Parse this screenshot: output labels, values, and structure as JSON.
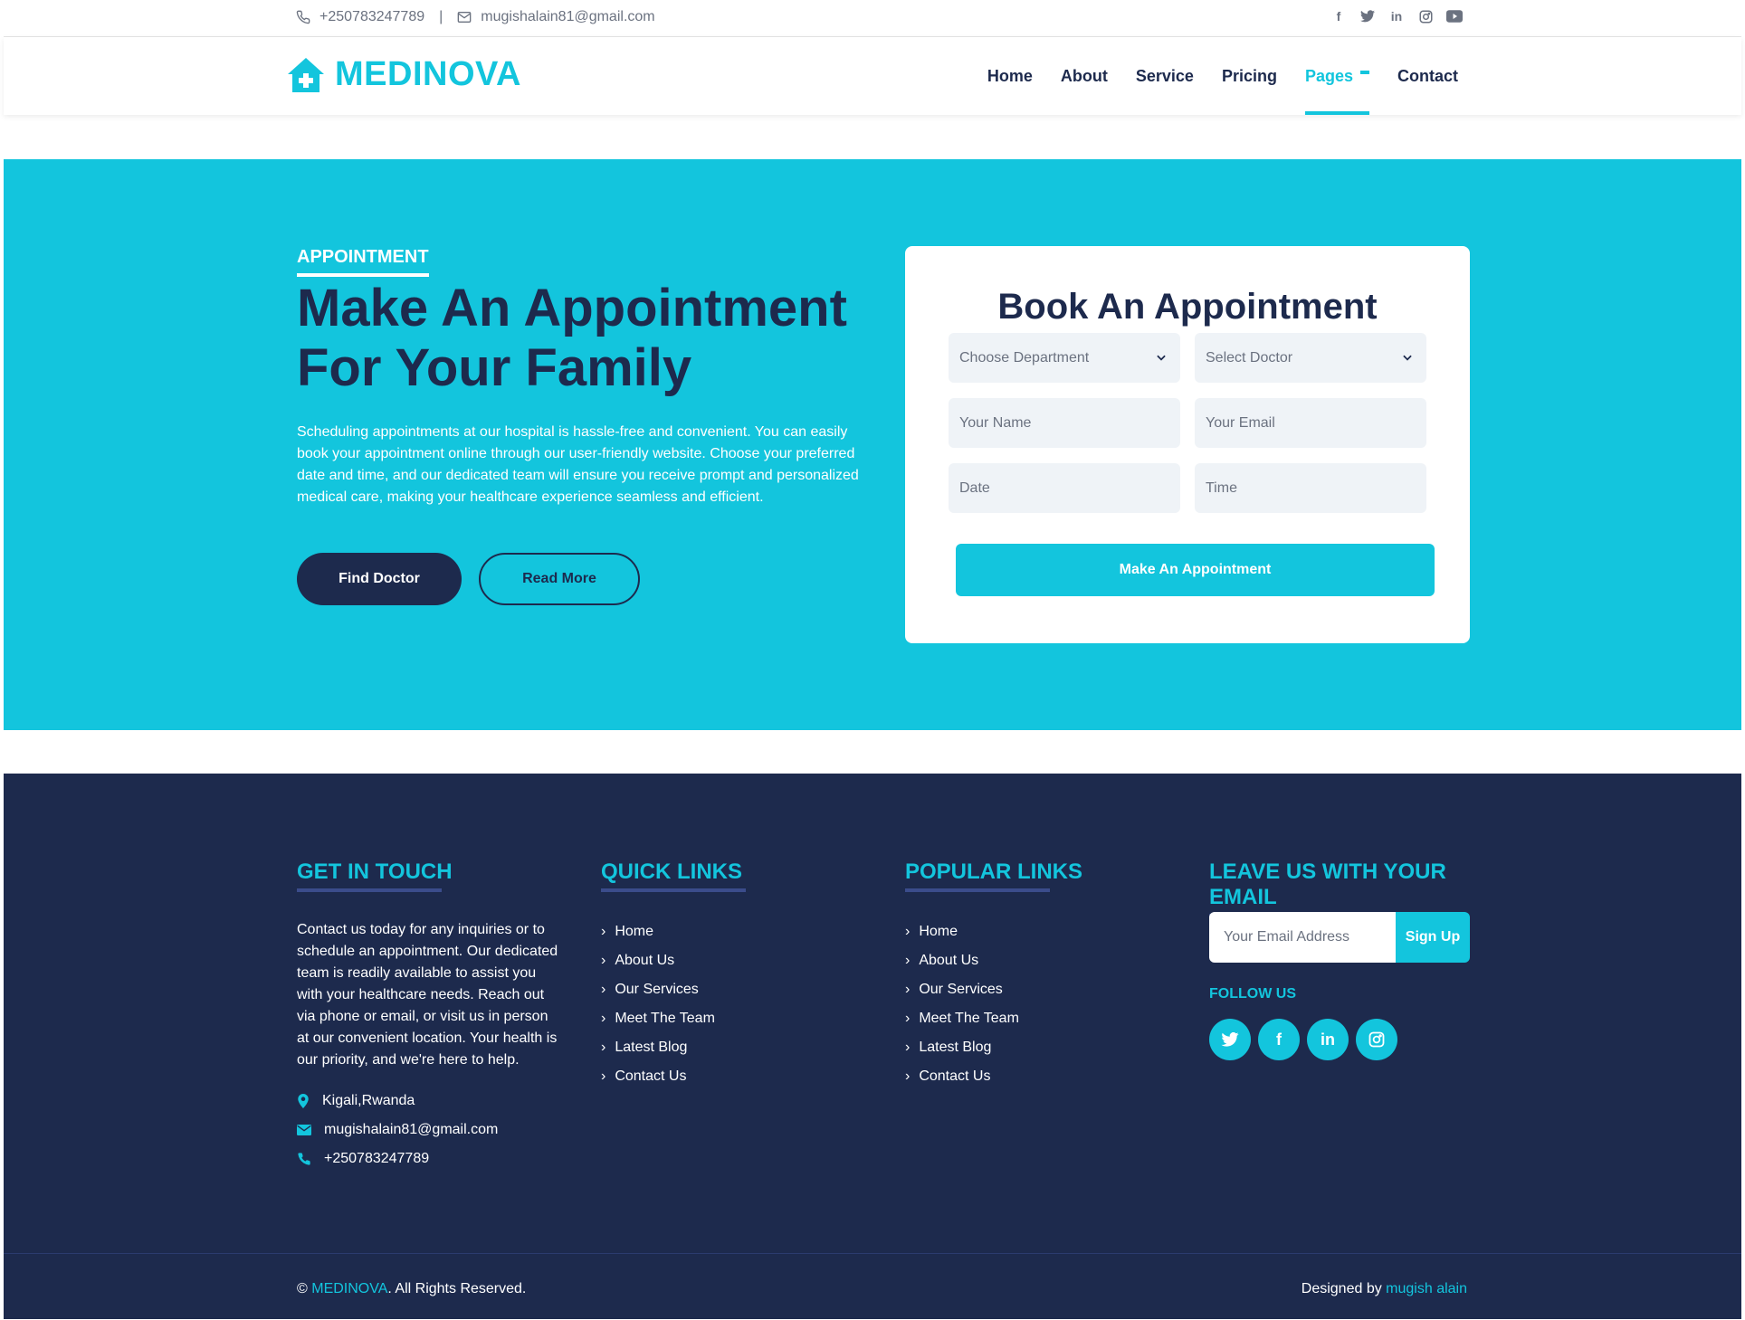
{
  "topbar": {
    "phone": "+250783247789",
    "separator": "|",
    "email": "mugishalain81@gmail.com"
  },
  "brand": {
    "name": "MEDINOVA",
    "accent": "#13c5dd",
    "dark": "#1d2a4d"
  },
  "nav": {
    "items": [
      "Home",
      "About",
      "Service",
      "Pricing",
      "Pages",
      "Contact"
    ],
    "active": "Pages"
  },
  "hero": {
    "kicker": "APPOINTMENT",
    "title": "Make An Appointment For Your Family",
    "description": "Scheduling appointments at our hospital is hassle-free and convenient. You can easily book your appointment online through our user-friendly website. Choose your preferred date and time, and our dedicated team will ensure you receive prompt and personalized medical care, making your healthcare experience seamless and efficient.",
    "primary_button": "Find Doctor",
    "secondary_button": "Read More"
  },
  "form": {
    "title": "Book An Appointment",
    "department_placeholder": "Choose Department",
    "doctor_placeholder": "Select Doctor",
    "name_placeholder": "Your Name",
    "email_placeholder": "Your Email",
    "date_placeholder": "Date",
    "time_placeholder": "Time",
    "submit": "Make An Appointment"
  },
  "footer": {
    "get_in_touch": {
      "title": "GET IN TOUCH",
      "text": "Contact us today for any inquiries or to schedule an appointment. Our dedicated team is readily available to assist you with your healthcare needs. Reach out via phone or email, or visit us in person at our convenient location. Your health is our priority, and we're here to help.",
      "location": "Kigali,Rwanda",
      "email": "mugishalain81@gmail.com",
      "phone": "+250783247789"
    },
    "quick_links": {
      "title": "QUICK LINKS",
      "items": [
        "Home",
        "About Us",
        "Our Services",
        "Meet The Team",
        "Latest Blog",
        "Contact Us"
      ]
    },
    "popular_links": {
      "title": "POPULAR LINKS",
      "items": [
        "Home",
        "About Us",
        "Our Services",
        "Meet The Team",
        "Latest Blog",
        "Contact Us"
      ]
    },
    "newsletter": {
      "title": "LEAVE US WITH YOUR EMAIL",
      "placeholder": "Your Email Address",
      "button": "Sign Up",
      "follow_label": "FOLLOW US"
    },
    "bottom": {
      "copyright_prefix": "©",
      "brand": "MEDINOVA",
      "copyright_suffix": ". All Rights Reserved.",
      "designed_by": "Designed by",
      "author": "mugish alain"
    }
  }
}
